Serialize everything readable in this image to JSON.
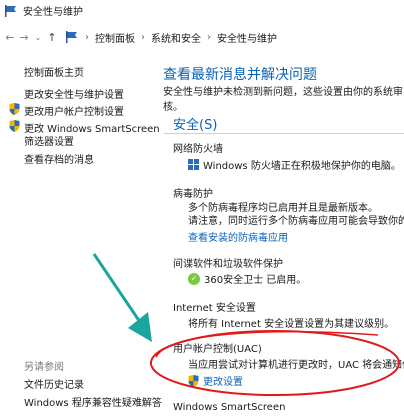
{
  "window": {
    "title": "安全性与维护"
  },
  "address_bar": {
    "crumbs": [
      "控制面板",
      "系统和安全",
      "安全性与维护"
    ]
  },
  "sidebar": {
    "home": "控制面板主页",
    "items": [
      "更改安全性与维护设置",
      "更改用户帐户控制设置",
      "更改 Windows SmartScreen",
      "筛选器设置",
      "查看存档的消息"
    ],
    "see_also_title": "另请参阅",
    "see_also": [
      "文件历史记录",
      "Windows 程序兼容性疑难解答"
    ]
  },
  "main": {
    "title": "查看最新消息并解决问题",
    "subtitle": "安全性与维护",
    "subtitle_text": "未检测到新问题，这些设置由你的系统审核。",
    "section": "安全(S)",
    "firewall": {
      "title": "网络防火墙",
      "status": "Windows 防火墙正在积极地保护你的电脑。"
    },
    "virus": {
      "title": "病毒防护",
      "line1": "多个防病毒程序均已启用并且是最新版本。",
      "line2": "请注意，同时运行多个防病毒应用可能会导致你的电脑运行",
      "link": "查看安装的防病毒应用"
    },
    "spyware": {
      "title": "间谍软件和垃圾软件保护",
      "status": "360安全卫士 已启用。"
    },
    "internet": {
      "title": "Internet 安全设置",
      "status": "将所有 Internet 安全设置设置为其建议级别。"
    },
    "uac": {
      "title": "用户帐户控制(UAC)",
      "status": "当应用尝试对计算机进行更改时，UAC 将会通知你。",
      "link": "更改设置"
    },
    "smartscreen": {
      "title": "Windows SmartScreen"
    }
  },
  "colors": {
    "accent": "#0a63b6",
    "annotation_red": "#e11b1b",
    "arrow": "#1aa5a0"
  }
}
